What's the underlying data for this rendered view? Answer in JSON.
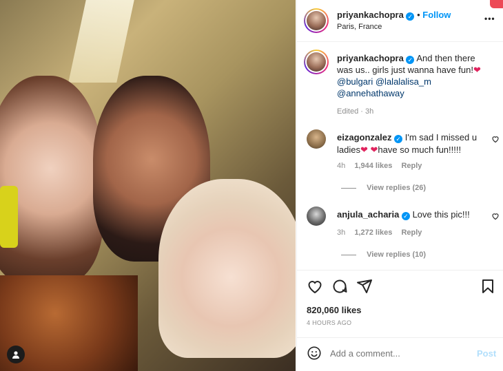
{
  "post": {
    "username": "priyankachopra",
    "location": "Paris, France",
    "follow_label": "Follow",
    "more_label": "•••",
    "caption": {
      "line1": "And then there",
      "line2": "was us.. girls just wanna have fun!",
      "mention1": "@bulgari",
      "mention2": "@lalalalisa_m",
      "mention3": "@annehathaway",
      "meta": "Edited · 3h"
    },
    "likes": "820,060 likes",
    "time_ago": "4 HOURS AGO",
    "comment_placeholder": "Add a comment...",
    "post_label": "Post"
  },
  "comments": [
    {
      "username": "eizagonzalez",
      "text1": "I'm sad I missed u",
      "text2a": "ladies",
      "text2b": "have so much fun!!!!!",
      "time": "4h",
      "likes": "1,944 likes",
      "reply": "Reply",
      "view_replies": "View replies (26)"
    },
    {
      "username": "anjula_acharia",
      "text1": "Love this pic!!!",
      "time": "3h",
      "likes": "1,272 likes",
      "reply": "Reply",
      "view_replies": "View replies (10)"
    }
  ],
  "icons": {
    "verified": "verified-badge-icon",
    "heart": "heart-icon",
    "comment": "comment-icon",
    "share": "share-icon",
    "save": "bookmark-icon",
    "emoji": "emoji-icon",
    "more": "more-options-icon"
  },
  "colors": {
    "accent": "#0095f6",
    "heart_red": "#e0245e",
    "muted": "#8e8e8e"
  }
}
